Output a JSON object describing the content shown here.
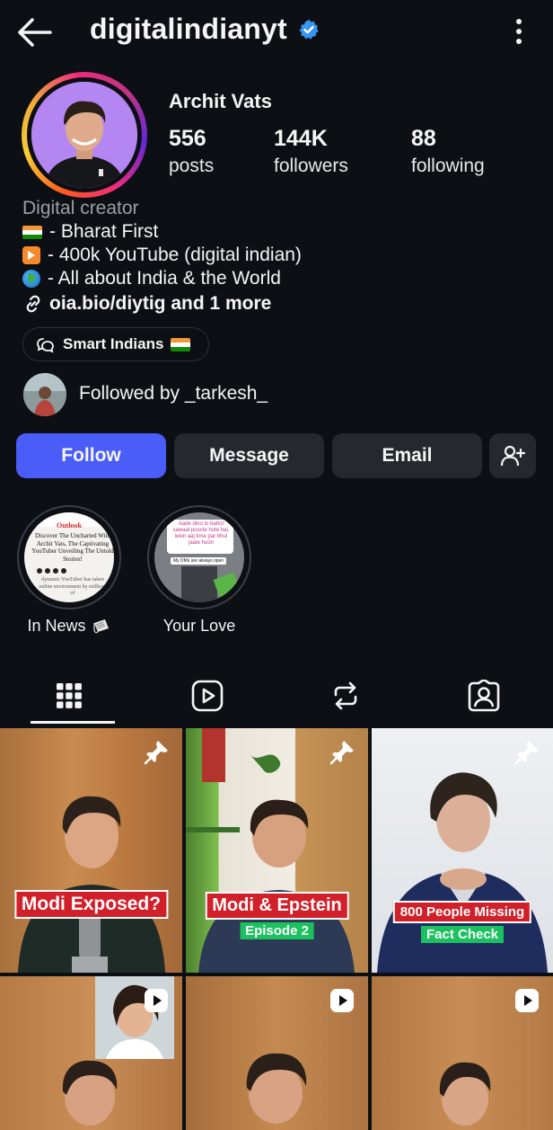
{
  "header": {
    "username": "digitalindianyt"
  },
  "profile": {
    "full_name": "Archit Vats",
    "stats": [
      {
        "value": "556",
        "label": "posts"
      },
      {
        "value": "144K",
        "label": "followers"
      },
      {
        "value": "88",
        "label": "following"
      }
    ],
    "category": "Digital creator",
    "bio": [
      "- Bharat First",
      "- 400k YouTube (digital indian)",
      "- All about India & the World"
    ],
    "link": "oia.bio/diytig and 1 more",
    "chip": "Smart Indians",
    "followed_by": "Followed by _tarkesh_"
  },
  "actions": {
    "follow": "Follow",
    "message": "Message",
    "email": "Email"
  },
  "highlights": [
    {
      "label": "In News",
      "thumb_title": "Outlook",
      "thumb_text": "Discover The Uncharted With Archit Vats, The Captivating YouTuber Unveiling The Untold Stories!",
      "thumb_small": "dynamic YouTuber has taken online environment by millions of"
    },
    {
      "label": "Your Love",
      "thumb_text": "Aade dino to bahot sawaal poocte hote hai, lekin aaj time par bhul jaate hoon",
      "thumb_small": "My DMs are always open"
    }
  ],
  "tabs": [
    "grid-icon",
    "reels-icon",
    "reposts-icon",
    "tagged-icon"
  ],
  "posts": [
    {
      "caption": "Modi Exposed?",
      "badge": "pin-icon"
    },
    {
      "caption": "Modi & Epstein",
      "subcaption": "Episode 2",
      "badge": "pin-icon"
    },
    {
      "caption": "800 People Missing",
      "subcaption": "Fact Check",
      "badge": "pin-icon"
    },
    {
      "badge": "reel-icon"
    },
    {
      "badge": "reel-icon"
    },
    {
      "badge": "reel-icon"
    }
  ],
  "colors": {
    "background": "#0c0f14",
    "follow_button": "#4a5df9",
    "button": "#25292f",
    "verified": "#3797f0",
    "caption_red": "#d2202a",
    "caption_green": "#1cc15f"
  }
}
